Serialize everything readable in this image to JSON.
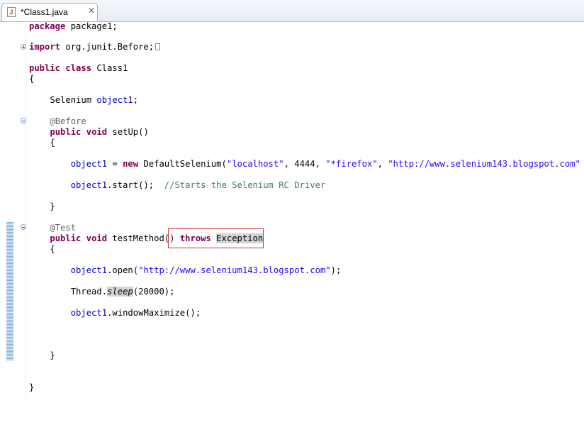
{
  "tab": {
    "title": "*Class1.java",
    "icon_letter": "J",
    "close_glyph": "✕"
  },
  "code": {
    "l1": {
      "kw": "package",
      "rest": " package1;"
    },
    "l2": {
      "kw": "import",
      "rest": " org.junit.Before;"
    },
    "l3": {
      "kw1": "public",
      "kw2": "class",
      "name": " Class1"
    },
    "l4": {
      "text": "{"
    },
    "l5": {
      "type": "Selenium ",
      "field": "object1",
      "end": ";"
    },
    "l6": {
      "ann": "@Before"
    },
    "l7": {
      "kw1": "public",
      "kw2": "void",
      "rest": " setUp()"
    },
    "l8": {
      "text": "{"
    },
    "l9": {
      "field": "object1",
      "op": " = ",
      "kw": "new",
      "cls": " DefaultSelenium(",
      "s1": "\"localhost\"",
      "c1": ", 4444, ",
      "s2": "\"*firefox\"",
      "c2": ", ",
      "s3": "\"http://www.selenium143.blogspot.com\"",
      "end": " );"
    },
    "l10": {
      "field": "object1",
      "call": ".start();  ",
      "comment": "//Starts the Selenium RC Driver"
    },
    "l11": {
      "text": "}"
    },
    "l12": {
      "ann": "@Test"
    },
    "l13": {
      "kw1": "public",
      "kw2": "void",
      "rest": " testMethod() ",
      "kw3": "throws",
      "exc": "Exception"
    },
    "l14": {
      "text": "{"
    },
    "l15": {
      "field": "object1",
      "call": ".open(",
      "s": "\"http://www.selenium143.blogspot.com\"",
      "end": ");"
    },
    "l16": {
      "cls": "Thread.",
      "method": "sleep",
      "end": "(20000);"
    },
    "l17": {
      "field": "object1",
      "call": ".windowMaximize();"
    },
    "l18": {
      "text": "}"
    },
    "l19": {
      "text": "}"
    }
  },
  "colors": {
    "keyword": "#7f0055",
    "field": "#0000c0",
    "string": "#2a00ff",
    "comment": "#3f7f5f",
    "annotation": "#646464",
    "highlight_box": "#d13438"
  },
  "icons": [
    "java-file-icon",
    "close-icon",
    "fold-expand-icon",
    "fold-collapse-icon"
  ]
}
